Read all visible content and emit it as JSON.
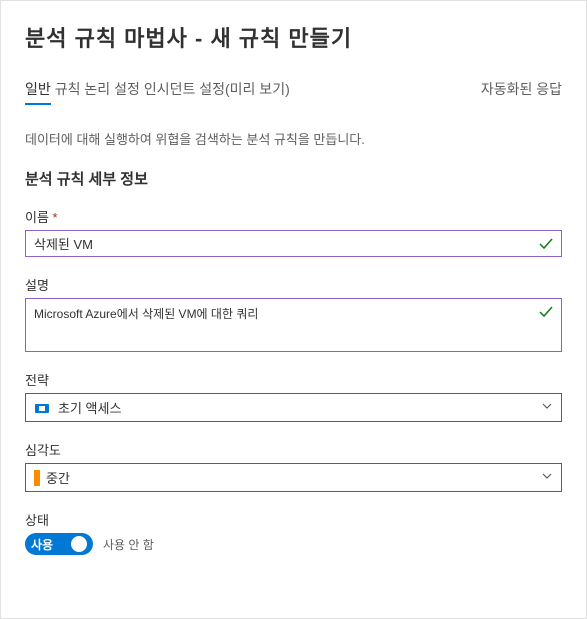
{
  "header": {
    "title": "분석 규칙 마법사 - 새 규칙 만들기"
  },
  "tabs": {
    "general": "일반",
    "ruleLogic": "규칙 논리 설정",
    "incidentSettings": "인시던트 설정(미리 보기)",
    "automatedResponse": "자동화된 응답"
  },
  "intro": {
    "description": "데이터에 대해 실행하여 위협을 검색하는 분석 규칙을 만듭니다.",
    "sectionTitle": "분석 규칙 세부 정보"
  },
  "form": {
    "name": {
      "label": "이름",
      "value": "삭제된 VM"
    },
    "description": {
      "label": "설명",
      "value": "Microsoft Azure에서 삭제된 VM에 대한 쿼리"
    },
    "tactics": {
      "label": "전략",
      "value": "초기 액세스"
    },
    "severity": {
      "label": "심각도",
      "value": "중간"
    },
    "status": {
      "label": "상태",
      "enabled": "사용",
      "disabled": "사용 안 함"
    }
  }
}
